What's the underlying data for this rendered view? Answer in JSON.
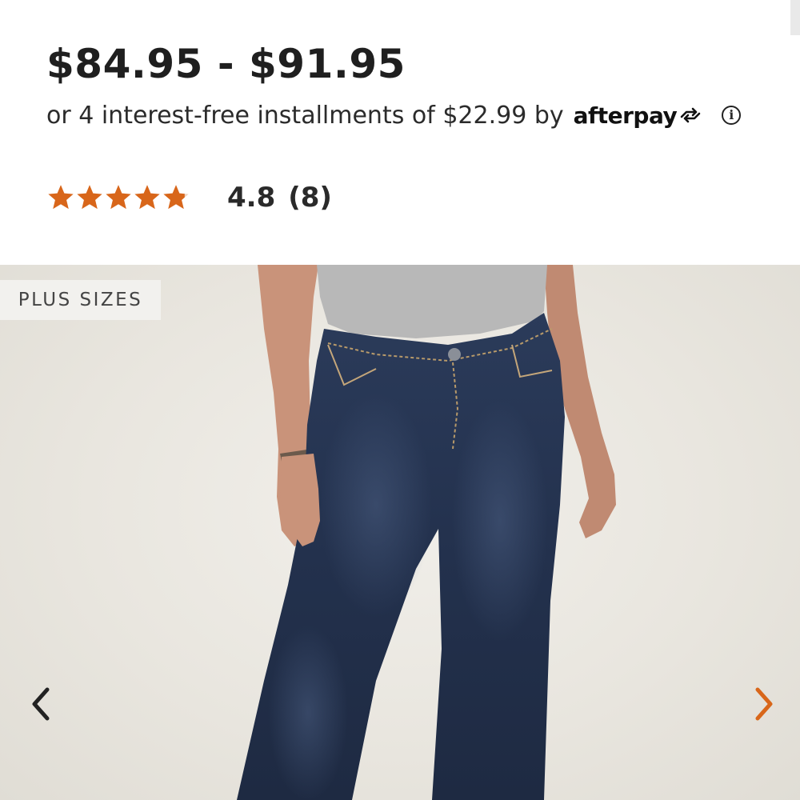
{
  "product": {
    "price_range": "$84.95 - $91.95",
    "installments_text": "or 4 interest-free installments of $22.99 by",
    "afterpay_brand": "afterpay",
    "info_symbol": "i"
  },
  "rating": {
    "value": "4.8",
    "count": "(8)",
    "stars_filled": 4.8,
    "stars_total": 5,
    "star_color": "#d8661a"
  },
  "gallery": {
    "badge": "PLUS SIZES",
    "prev_arrow_color": "#222222",
    "next_arrow_color": "#d8661a",
    "prev_icon": "chevron-left-icon",
    "next_icon": "chevron-right-icon"
  }
}
